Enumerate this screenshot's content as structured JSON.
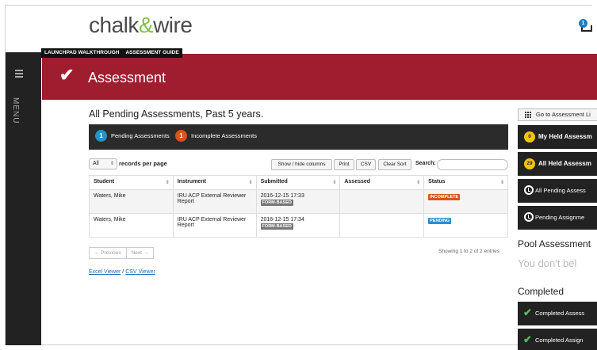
{
  "brand": {
    "logo_part1": "chalk",
    "logo_amp": "&",
    "logo_part2": "wire",
    "notification_count": "1"
  },
  "sidebar": {
    "menu_label": "MENU"
  },
  "help_bar": {
    "walkthrough": "LAUNCHPAD WALKTHROUGH",
    "guide": "ASSESSMENT GUIDE"
  },
  "banner": {
    "title": "Assessment"
  },
  "main": {
    "heading": "All Pending Assessments, Past 5 years.",
    "summary": {
      "pending_count": "1",
      "pending_label": "Pending Assessments",
      "incomplete_count": "1",
      "incomplete_label": "Incomplete Assessments"
    },
    "controls": {
      "records_value": "All",
      "records_label": "records per page",
      "show_hide": "Show / hide columns",
      "print": "Print",
      "csv": "CSV",
      "clear_sort": "Clear Sort",
      "search_label": "Search:"
    },
    "table": {
      "headers": [
        "Student",
        "Instrument",
        "Submitted",
        "Assessed",
        "Status"
      ],
      "rows": [
        {
          "student": "Waters, Mike",
          "instrument": "IRU ACP External Reviewer Report",
          "submitted": "2016-12-15 17:33",
          "form_tag": "FORM-BASED",
          "assessed": "",
          "status": "INCOMPLETE"
        },
        {
          "student": "Waters, Mike",
          "instrument": "IRU ACP External Reviewer Report",
          "submitted": "2016-12-15 17:34",
          "form_tag": "FORM-BASED",
          "assessed": "",
          "status": "PENDING"
        }
      ]
    },
    "pager": {
      "previous": "← Previous",
      "next": "Next →",
      "showing": "Showing 1 to 2 of 2 entries"
    },
    "viewers": {
      "excel": "Excel Viewer",
      "separator": " / ",
      "csv": "CSV Viewer"
    }
  },
  "right_panel": {
    "go_button": "Go to Assessment Li",
    "held_count": "0",
    "held_label": "My Held Assessm",
    "all_held_count": "29",
    "all_held_label": "All Held Assessm",
    "all_pending_label": "All Pending Assess",
    "pending_assign_label": "Pending Assignme",
    "pool_title": "Pool Assessment",
    "pool_message": "You don't bel",
    "completed_title": "Completed",
    "completed_assess": "Completed Assess",
    "completed_assign": "Completed Assign"
  },
  "colors": {
    "banner": "#a01d2f",
    "accent_green": "#7cc142",
    "incomplete": "#d9531e",
    "pending": "#2a8fc8"
  }
}
